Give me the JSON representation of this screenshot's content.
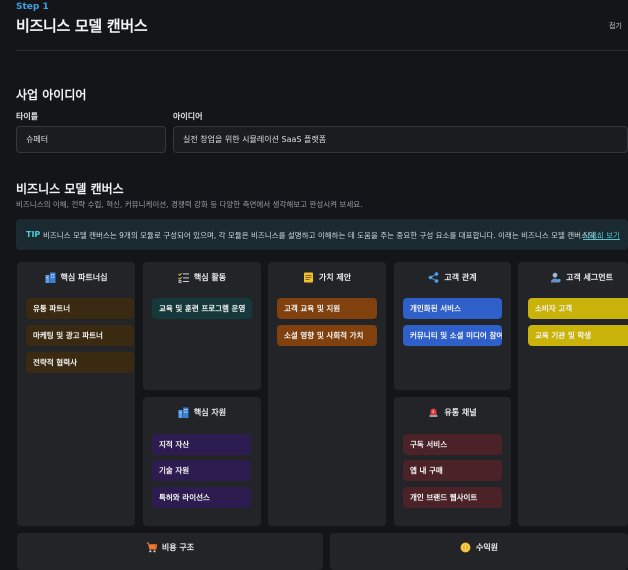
{
  "header": {
    "step": "Step 1",
    "title": "비즈니스 모델 캔버스",
    "close_label": "접기"
  },
  "idea": {
    "heading": "사업 아이디어",
    "title_label": "타이틀",
    "title_value": "슈페터",
    "idea_label": "아이디어",
    "idea_value": "실전 창업을 위한 시뮬레이션 SaaS 플랫폼"
  },
  "canvas": {
    "heading": "비즈니스 모델 캔버스",
    "description": "비즈니스의 이해, 전략 수립, 혁신, 커뮤니케이션, 경쟁력 강화 등 다양한 측면에서 생각해보고 완성시켜 보세요.",
    "tip_tag": "TIP",
    "tip_text": "비즈니스 모델 캔버스는 9개의 모듈로 구성되어 있으며, 각 모듈은 비즈니스를 설명하고 이해하는 데 도움을 주는 중요한 구성 요소를 대표합니다. 이래는 비즈니스 모델 캔버스의...",
    "tip_link": "자세히 보기",
    "blocks": {
      "partners": {
        "title": "핵심 파트너십",
        "icon": "building-icon",
        "items": [
          "유통 파트너",
          "마케팅 및 광고 파트너",
          "전략적 협력사"
        ]
      },
      "activities": {
        "title": "핵심 활동",
        "icon": "checklist-icon",
        "items": [
          "교육 및 훈련 프로그램 운영"
        ]
      },
      "resources": {
        "title": "핵심 자원",
        "icon": "building-icon",
        "items": [
          "지적 자산",
          "기술 자원",
          "특허와 라이선스"
        ]
      },
      "value": {
        "title": "가치 제안",
        "icon": "note-icon",
        "items": [
          "고객 교육 및 지원",
          "소셜 영향 및 사회적 가치"
        ]
      },
      "relations": {
        "title": "고객 관계",
        "icon": "share-icon",
        "items": [
          "개인화된 서비스",
          "커뮤니티 및 소셜 미디어 참여"
        ]
      },
      "channels": {
        "title": "유통 채널",
        "icon": "siren-icon",
        "items": [
          "구독 서비스",
          "앱 내 구매",
          "개인 브랜드 웹사이트"
        ]
      },
      "segments": {
        "title": "고객 세그먼트",
        "icon": "user-icon",
        "items": [
          "소비자 고객",
          "교육 기관 및 학생"
        ]
      },
      "costs": {
        "title": "비용 구조",
        "icon": "cart-icon"
      },
      "revenue": {
        "title": "수익원",
        "icon": "coin-icon"
      }
    }
  },
  "colors": {
    "partners": "#3a2a12",
    "activities": "#15393b",
    "resources": "#2d1c4f",
    "value": "#80410e",
    "relations": "#2f5fc9",
    "channels": "#4a2227",
    "segments": "#c9b30a",
    "accent": "#3da0e0"
  }
}
